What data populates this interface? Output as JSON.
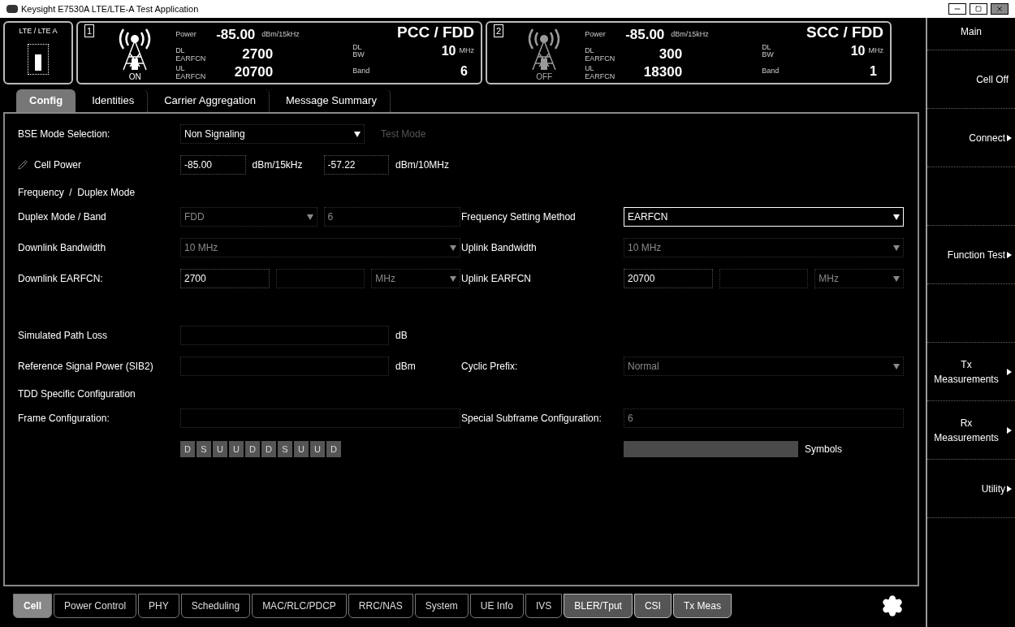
{
  "window": {
    "title": "Keysight E7530A LTE/LTE-A Test Application"
  },
  "mode_box": {
    "label": "LTE / LTE A"
  },
  "cells": [
    {
      "index": "1",
      "on": true,
      "status": "ON",
      "power_label": "Power",
      "power": "-85.00",
      "power_unit": "dBm/15kHz",
      "title": "PCC / FDD",
      "earfcn": [
        {
          "label": "DL EARFCN",
          "value": "2700"
        },
        {
          "label": "UL EARFCN",
          "value": "20700"
        }
      ],
      "bw_label": "DL BW",
      "bw": "10",
      "bw_unit": "MHz",
      "band_label": "Band",
      "band": "6"
    },
    {
      "index": "2",
      "on": false,
      "status": "OFF",
      "power_label": "Power",
      "power": "-85.00",
      "power_unit": "dBm/15kHz",
      "title": "SCC / FDD",
      "earfcn": [
        {
          "label": "DL EARFCN",
          "value": "300"
        },
        {
          "label": "UL EARFCN",
          "value": "18300"
        }
      ],
      "bw_label": "DL BW",
      "bw": "10",
      "bw_unit": "MHz",
      "band_label": "Band",
      "band": "1"
    }
  ],
  "tabs": [
    {
      "label": "Config",
      "selected": true
    },
    {
      "label": "Identities",
      "selected": false
    },
    {
      "label": "Carrier Aggregation",
      "selected": false
    },
    {
      "label": "Message Summary",
      "selected": false
    }
  ],
  "form": [
    {
      "kind": "fields",
      "left": {
        "label": "BSE Mode Selection:",
        "controls": [
          {
            "kind": "dropdown",
            "value": "Non Signaling",
            "disabled": false
          },
          {
            "kind": "note",
            "value": "Test Mode"
          }
        ]
      }
    },
    {
      "kind": "fields",
      "left": {
        "label": "Cell Power",
        "icon": true,
        "controls": [
          {
            "kind": "input",
            "value": "-85.00",
            "disabled": false
          },
          {
            "kind": "unit",
            "value": "dBm/15kHz"
          },
          {
            "kind": "input",
            "value": "-57.22",
            "disabled": false
          },
          {
            "kind": "unit",
            "value": "dBm/10MHz"
          }
        ]
      }
    },
    {
      "kind": "section",
      "label": "Frequency  /  Duplex Mode"
    },
    {
      "kind": "fields",
      "left": {
        "label": "Duplex Mode  /  Band",
        "controls": [
          {
            "kind": "dropdown",
            "value": "FDD",
            "disabled": true
          },
          {
            "kind": "input",
            "value": "6",
            "disabled": true
          }
        ]
      },
      "right": {
        "label": "Frequency Setting Method",
        "controls": [
          {
            "kind": "dropdown",
            "value": "EARFCN",
            "disabled": false,
            "focused": true
          }
        ]
      }
    },
    {
      "kind": "fields",
      "left": {
        "label": "Downlink Bandwidth",
        "controls": [
          {
            "kind": "dropdown",
            "value": "10 MHz",
            "disabled": true
          }
        ]
      },
      "right": {
        "label": "Uplink Bandwidth",
        "controls": [
          {
            "kind": "dropdown",
            "value": "10 MHz",
            "disabled": true
          }
        ]
      }
    },
    {
      "kind": "fields",
      "left": {
        "label": "Downlink EARFCN:",
        "controls": [
          {
            "kind": "input",
            "value": "2700",
            "disabled": false
          },
          {
            "kind": "input",
            "disabled": true
          },
          {
            "kind": "dropdown",
            "value": "MHz",
            "disabled": true
          }
        ]
      },
      "right": {
        "label": "Uplink EARFCN",
        "controls": [
          {
            "kind": "input",
            "value": "20700",
            "disabled": false
          },
          {
            "kind": "input",
            "disabled": true
          },
          {
            "kind": "dropdown",
            "value": "MHz",
            "disabled": true
          }
        ]
      }
    },
    {
      "kind": "gap"
    },
    {
      "kind": "fields",
      "left": {
        "label": "Simulated Path Loss",
        "controls": [
          {
            "kind": "input",
            "disabled": true
          },
          {
            "kind": "unit",
            "value": "dB"
          }
        ]
      }
    },
    {
      "kind": "fields",
      "left": {
        "label": "Reference Signal Power (SIB2)",
        "controls": [
          {
            "kind": "input",
            "disabled": true
          },
          {
            "kind": "unit",
            "value": "dBm"
          }
        ]
      },
      "right": {
        "label": "Cyclic Prefix:",
        "controls": [
          {
            "kind": "dropdown",
            "value": "Normal",
            "disabled": true
          }
        ]
      }
    },
    {
      "kind": "section",
      "label": "TDD Specific Configuration"
    },
    {
      "kind": "fields",
      "left": {
        "label": "Frame Configuration:",
        "controls": [
          {
            "kind": "input",
            "disabled": true
          }
        ]
      },
      "right": {
        "label": "Special Subframe Configuration:",
        "controls": [
          {
            "kind": "input",
            "value": "6",
            "disabled": true
          }
        ]
      }
    },
    {
      "kind": "fields",
      "left": {
        "controls": [
          {
            "kind": "subframes",
            "letters": [
              "D",
              "S",
              "U",
              "U",
              "D",
              "D",
              "S",
              "U",
              "U",
              "D"
            ]
          }
        ]
      },
      "right": {
        "controls": [
          {
            "kind": "symbols"
          },
          {
            "kind": "unit",
            "value": "Symbols"
          }
        ]
      }
    }
  ],
  "softkeys": [
    {
      "label": "Main",
      "kind": "heading"
    },
    {
      "label": "Cell Off",
      "kind": "button"
    },
    {
      "label": "Connect",
      "kind": "menu"
    },
    {
      "kind": "blank"
    },
    {
      "label": "Function Test",
      "kind": "menu"
    },
    {
      "kind": "blank"
    },
    {
      "label": "Tx Measurements",
      "kind": "menu"
    },
    {
      "label": "Rx Measurements",
      "kind": "menu"
    },
    {
      "label": "Utility",
      "kind": "menu"
    }
  ],
  "bottom_tabs": [
    {
      "label": "Cell",
      "selected": true,
      "shaded": false
    },
    {
      "label": "Power Control",
      "selected": false,
      "shaded": false
    },
    {
      "label": "PHY",
      "selected": false,
      "shaded": false
    },
    {
      "label": "Scheduling",
      "selected": false,
      "shaded": false
    },
    {
      "label": "MAC/RLC/PDCP",
      "selected": false,
      "shaded": false
    },
    {
      "label": "RRC/NAS",
      "selected": false,
      "shaded": false
    },
    {
      "label": "System",
      "selected": false,
      "shaded": false
    },
    {
      "label": "UE Info",
      "selected": false,
      "shaded": false
    },
    {
      "label": "IVS",
      "selected": false,
      "shaded": false
    },
    {
      "label": "BLER/Tput",
      "selected": false,
      "shaded": true
    },
    {
      "label": "CSI",
      "selected": false,
      "shaded": true
    },
    {
      "label": "Tx Meas",
      "selected": false,
      "shaded": true
    }
  ]
}
